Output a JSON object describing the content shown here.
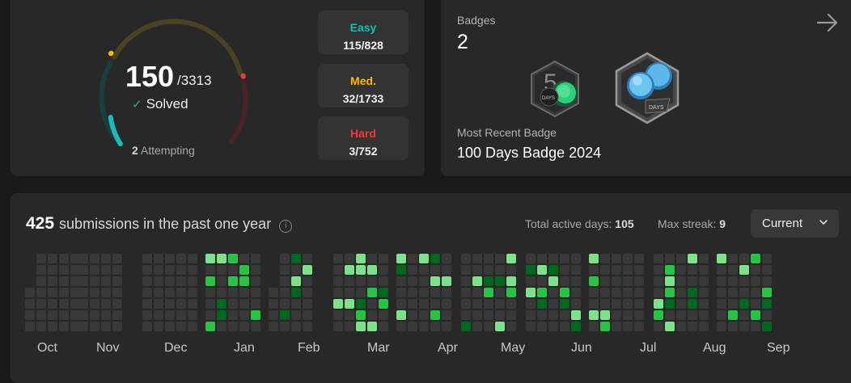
{
  "progress": {
    "solved": "150",
    "total": "/3313",
    "solved_label": "Solved",
    "attempting_count": "2",
    "attempting_label": "Attempting",
    "difficulties": [
      {
        "label": "Easy",
        "value": "115/828",
        "color": "#1cbaba"
      },
      {
        "label": "Med.",
        "value": "32/1733",
        "color": "#ffb700"
      },
      {
        "label": "Hard",
        "value": "3/752",
        "color": "#f63737"
      }
    ]
  },
  "badges": {
    "label": "Badges",
    "count": "2",
    "recent_label": "Most Recent Badge",
    "recent_name": "100 Days Badge 2024",
    "items": [
      {
        "icon": "50-days-badge-icon",
        "text": "DAYS"
      },
      {
        "icon": "100-days-badge-icon",
        "text": "DAYS"
      }
    ]
  },
  "calendar": {
    "count": "425",
    "title_text": "submissions in the past one year",
    "active_days_label": "Total active days:",
    "active_days": "105",
    "max_streak_label": "Max streak:",
    "max_streak": "9",
    "dropdown_value": "Current",
    "months": [
      "Oct",
      "Nov",
      "Dec",
      "Jan",
      "Feb",
      "Mar",
      "Apr",
      "May",
      "Jun",
      "Jul",
      "Aug",
      "Sep"
    ],
    "colors": {
      "empty": "#393939",
      "l1": "#016620",
      "l2": "#28c244",
      "l3": "#7fe18b"
    }
  }
}
